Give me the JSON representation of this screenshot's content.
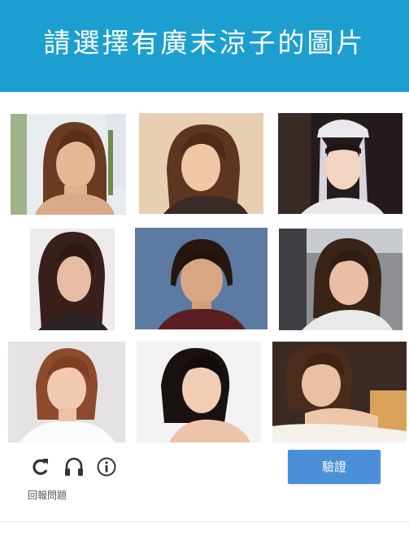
{
  "header": {
    "title": "請選擇有廣末涼子的圖片",
    "background_color": "#1c9fd0"
  },
  "grid": {
    "tiles": [
      {
        "index": 1,
        "selected": false
      },
      {
        "index": 2,
        "selected": false
      },
      {
        "index": 3,
        "selected": false
      },
      {
        "index": 4,
        "selected": false
      },
      {
        "index": 5,
        "selected": false
      },
      {
        "index": 6,
        "selected": false
      },
      {
        "index": 7,
        "selected": false
      },
      {
        "index": 8,
        "selected": false
      },
      {
        "index": 9,
        "selected": false
      }
    ]
  },
  "footer": {
    "icons": [
      "reload-icon",
      "audio-icon",
      "info-icon"
    ],
    "report_label": "回報問題",
    "verify_label": "驗證",
    "verify_color": "#4a90d9"
  }
}
